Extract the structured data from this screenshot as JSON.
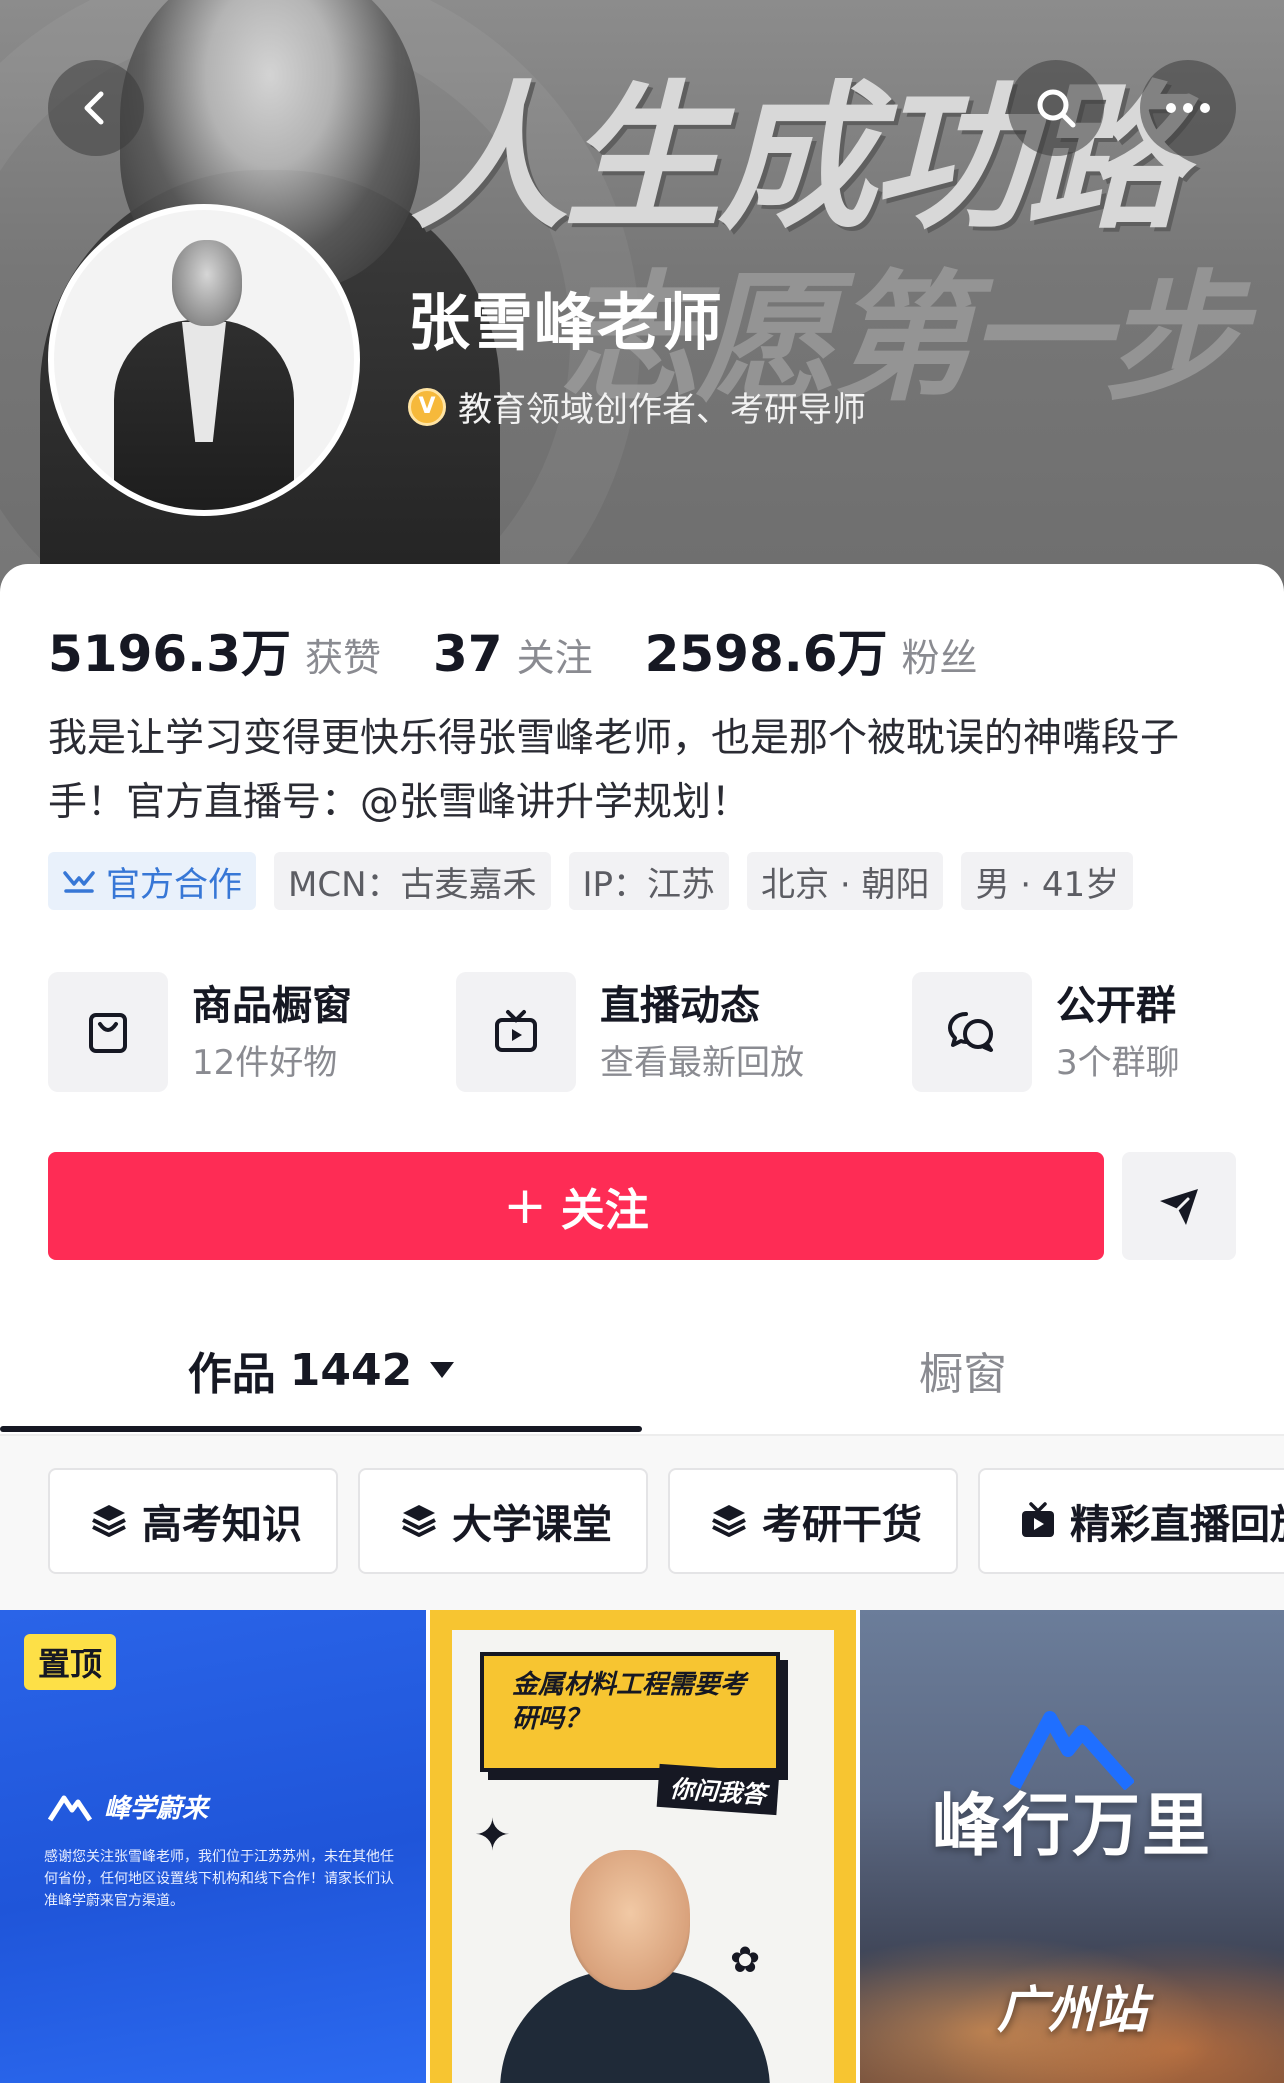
{
  "header": {
    "banner_slogan_line1": "人生成功路",
    "banner_slogan_line2": "志愿第一步",
    "name": "张雪峰老师",
    "verification_icon": "V",
    "verification": "教育领域创作者、考研导师",
    "icons": [
      "back-icon",
      "search-icon",
      "more-icon"
    ]
  },
  "stats": [
    {
      "value": "5196.3万",
      "label": "获赞"
    },
    {
      "value": "37",
      "label": "关注"
    },
    {
      "value": "2598.6万",
      "label": "粉丝"
    }
  ],
  "bio": "我是让学习变得更快乐得张雪峰老师，也是那个被耽误的神嘴段子手！官方直播号：@张雪峰讲升学规划！",
  "tags": {
    "official": "官方合作",
    "mcn": "MCN：古麦嘉禾",
    "ip": "IP：江苏",
    "location": "北京 · 朝阳",
    "gender_age": "男 · 41岁"
  },
  "features": [
    {
      "title": "商品橱窗",
      "subtitle": "12件好物",
      "icon": "shopping-bag-icon"
    },
    {
      "title": "直播动态",
      "subtitle": "查看最新回放",
      "icon": "tv-icon"
    },
    {
      "title": "公开群",
      "subtitle": "3个群聊",
      "icon": "chat-bubbles-icon"
    }
  ],
  "actions": {
    "follow_label": "关注",
    "message_icon": "send-icon"
  },
  "tabs": {
    "works_label": "作品",
    "works_count": "1442",
    "shop_label": "橱窗"
  },
  "collections": [
    {
      "label": "高考知识",
      "icon": "layers-icon"
    },
    {
      "label": "大学课堂",
      "icon": "layers-icon"
    },
    {
      "label": "考研干货",
      "icon": "layers-icon"
    },
    {
      "label": "精彩直播回放",
      "icon": "tv-icon"
    }
  ],
  "videos": {
    "v1": {
      "pinned": "置顶",
      "brand": "峰学蔚来",
      "notice": "感谢您关注张雪峰老师，我们位于江苏苏州，未在其他任何省份，任何地区设置线下机构和线下合作！请家长们认准峰学蔚来官方渠道。"
    },
    "v2": {
      "question": "金属材料工程需要考研吗？",
      "ask": "你问我答"
    },
    "v3": {
      "title": "峰行万里",
      "city": "广州站"
    }
  },
  "colors": {
    "follow": "#fe2c55",
    "official_tag": "#3777d6",
    "pin_badge": "#fde047"
  }
}
